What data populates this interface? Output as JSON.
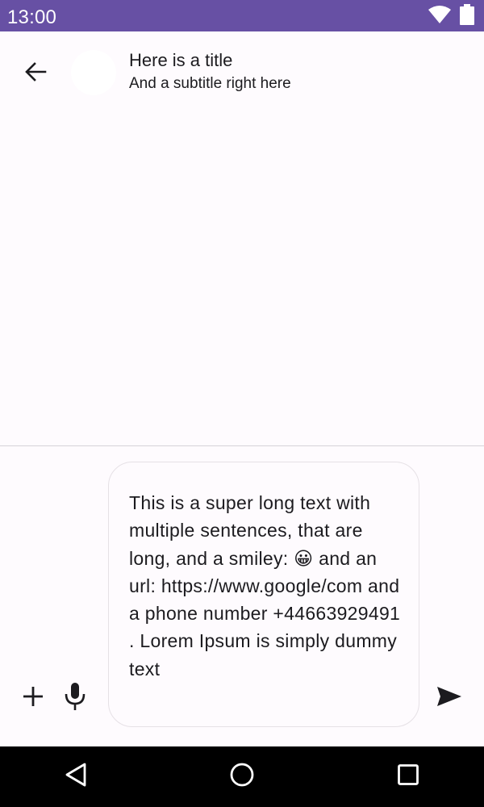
{
  "status_bar": {
    "time": "13:00",
    "icons": [
      "wifi-icon",
      "battery-icon"
    ],
    "background": "#6750a4"
  },
  "app_bar": {
    "back_icon": "arrow-back-icon",
    "title": "Here is a title",
    "subtitle": "And a subtitle right here"
  },
  "composer": {
    "text": "This is a super long text with multiple sentences, that are long, and a smiley: 😀 and an url: https://www.google/com and a phone number +44663929491 . Lorem Ipsum is simply dummy text",
    "add_icon": "plus-icon",
    "mic_icon": "microphone-icon",
    "send_icon": "send-icon"
  },
  "nav_bar": {
    "buttons": [
      "back-triangle-icon",
      "home-circle-icon",
      "recents-square-icon"
    ]
  },
  "colors": {
    "primary": "#6750a4",
    "background": "#fefbfe",
    "text": "#1c1b1f"
  }
}
